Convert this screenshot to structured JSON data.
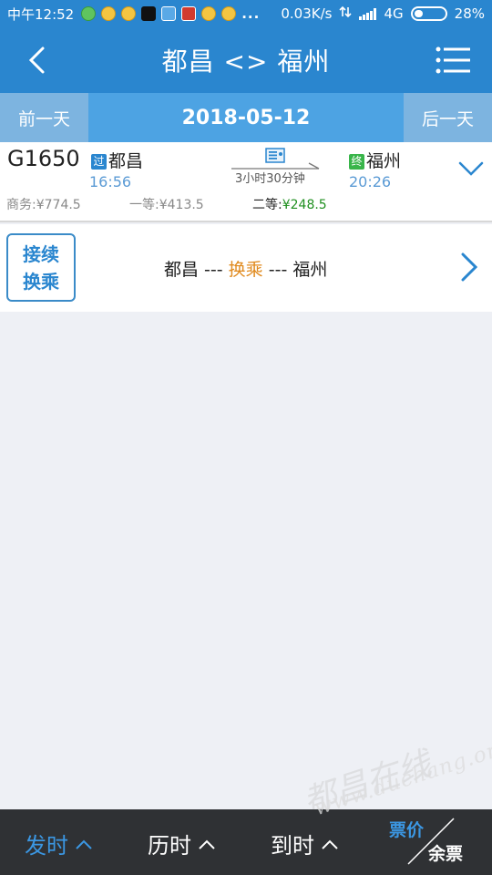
{
  "status_bar": {
    "time": "中午12:52",
    "speed": "0.03K/s",
    "network": "4G",
    "battery": "28%",
    "battery_level": 0.28,
    "dots": "..."
  },
  "nav": {
    "title": "都昌 <> 福州"
  },
  "date_bar": {
    "prev_label": "前一天",
    "date": "2018-05-12",
    "next_label": "后一天"
  },
  "train": {
    "number": "G1650",
    "dep_tag": "过",
    "dep_station": "都昌",
    "dep_time": "16:56",
    "duration": "3小时30分钟",
    "arr_tag": "终",
    "arr_station": "福州",
    "arr_time": "20:26",
    "business_label": "商务:",
    "business_price": "¥774.5",
    "first_label": "一等:",
    "first_price": "¥413.5",
    "second_label": "二等:",
    "second_price": "¥248.5"
  },
  "transfer": {
    "badge_line1": "接续",
    "badge_line2": "换乘",
    "from": "都昌",
    "sep1": " --- ",
    "mid": "换乘",
    "sep2": " --- ",
    "to": "福州"
  },
  "bottom": {
    "depart_label": "发时",
    "duration_label": "历时",
    "arrive_label": "到时",
    "price_label": "票价",
    "remaining_label": "余票"
  },
  "watermark": {
    "chinese": "都昌在线",
    "url": "www.duchang.org"
  },
  "colors": {
    "primary": "#2a86cf",
    "date_side": "#7db4e0",
    "date_center": "#4da3e3",
    "green_price": "#1f8f1f",
    "transfer_orange": "#e08a1e",
    "bottom_bg": "#2f3134"
  }
}
